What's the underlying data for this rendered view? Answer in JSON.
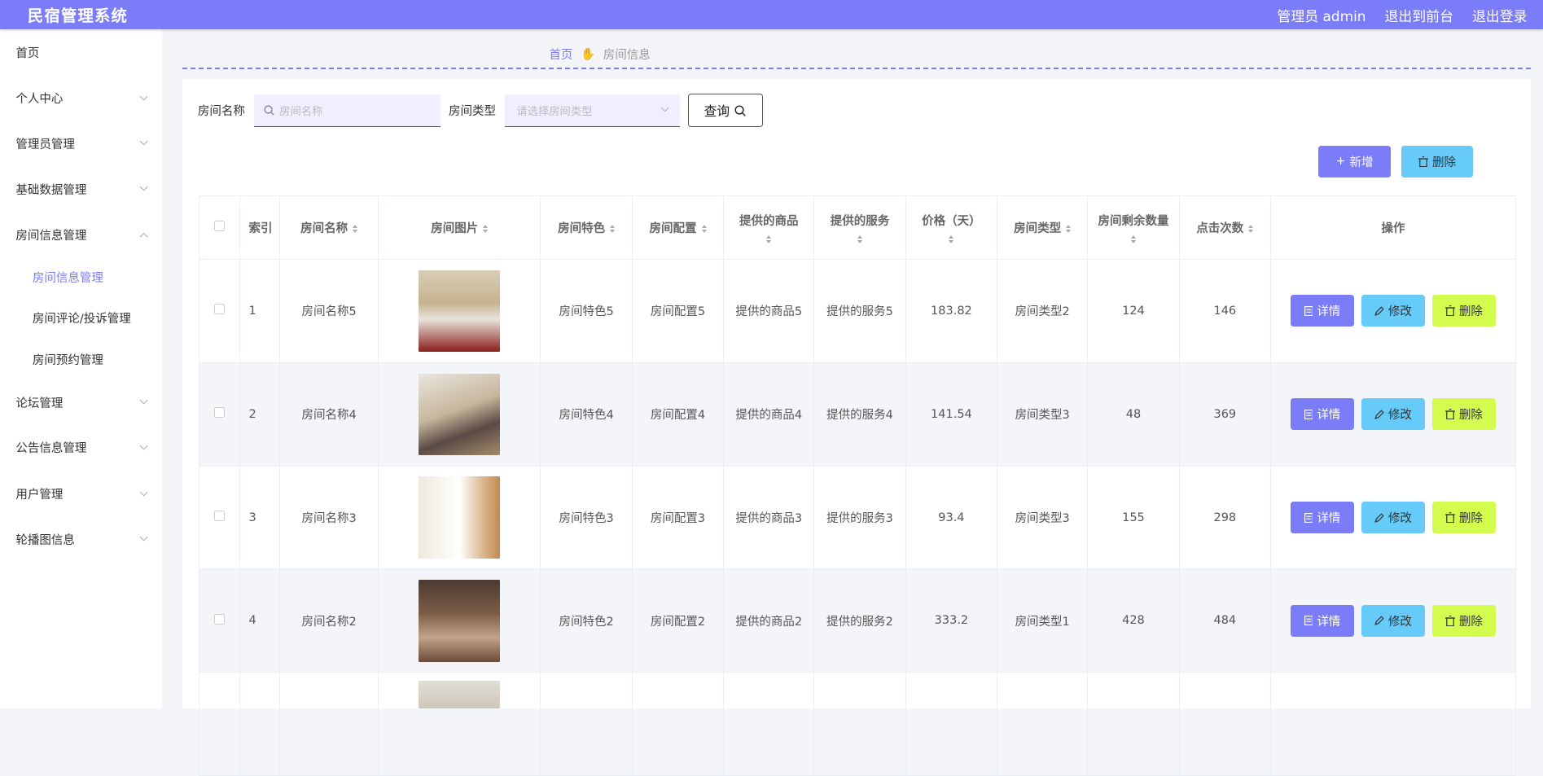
{
  "app": {
    "title": "民宿管理系统"
  },
  "topbar": {
    "user": "管理员 admin",
    "front": "退出到前台",
    "logout": "退出登录"
  },
  "sidebar": {
    "items": [
      {
        "label": "首页"
      },
      {
        "label": "个人中心"
      },
      {
        "label": "管理员管理"
      },
      {
        "label": "基础数据管理"
      },
      {
        "label": "房间信息管理"
      },
      {
        "label": "房间信息管理"
      },
      {
        "label": "房间评论/投诉管理"
      },
      {
        "label": "房间预约管理"
      },
      {
        "label": "论坛管理"
      },
      {
        "label": "公告信息管理"
      },
      {
        "label": "用户管理"
      },
      {
        "label": "轮播图信息"
      }
    ]
  },
  "breadcrumb": {
    "home": "首页",
    "current": "房间信息"
  },
  "search": {
    "name_label": "房间名称",
    "name_placeholder": "房间名称",
    "type_label": "房间类型",
    "type_placeholder": "请选择房间类型",
    "query_label": "查询"
  },
  "actions": {
    "add": "新增",
    "delete": "删除"
  },
  "table": {
    "headers": [
      "索引",
      "房间名称",
      "房间图片",
      "房间特色",
      "房间配置",
      "提供的商品",
      "提供的服务",
      "价格（天）",
      "房间类型",
      "房间剩余数量",
      "点击次数",
      "操作"
    ],
    "rows": [
      {
        "idx": "1",
        "name": "房间名称5",
        "feature": "房间特色5",
        "config": "房间配置5",
        "goods": "提供的商品5",
        "service": "提供的服务5",
        "price": "183.82",
        "type": "房间类型2",
        "remain": "124",
        "clicks": "146"
      },
      {
        "idx": "2",
        "name": "房间名称4",
        "feature": "房间特色4",
        "config": "房间配置4",
        "goods": "提供的商品4",
        "service": "提供的服务4",
        "price": "141.54",
        "type": "房间类型3",
        "remain": "48",
        "clicks": "369"
      },
      {
        "idx": "3",
        "name": "房间名称3",
        "feature": "房间特色3",
        "config": "房间配置3",
        "goods": "提供的商品3",
        "service": "提供的服务3",
        "price": "93.4",
        "type": "房间类型3",
        "remain": "155",
        "clicks": "298"
      },
      {
        "idx": "4",
        "name": "房间名称2",
        "feature": "房间特色2",
        "config": "房间配置2",
        "goods": "提供的商品2",
        "service": "提供的服务2",
        "price": "333.2",
        "type": "房间类型1",
        "remain": "428",
        "clicks": "484"
      }
    ],
    "row_actions": {
      "view": "详情",
      "edit": "修改",
      "delete": "删除"
    }
  },
  "colors": {
    "accent": "#7b7cf7",
    "info": "#67cbfa",
    "warn": "#d3fc4f"
  }
}
